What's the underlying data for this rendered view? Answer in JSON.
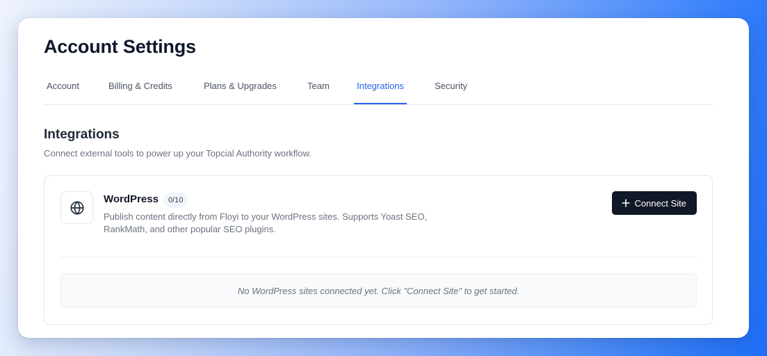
{
  "page": {
    "title": "Account Settings"
  },
  "tabs": [
    {
      "label": "Account"
    },
    {
      "label": "Billing & Credits"
    },
    {
      "label": "Plans & Upgrades"
    },
    {
      "label": "Team"
    },
    {
      "label": "Integrations",
      "active": true
    },
    {
      "label": "Security"
    }
  ],
  "section": {
    "title": "Integrations",
    "description": "Connect external tools to power up your Topcial Authority workflow."
  },
  "integration": {
    "icon": "globe-icon",
    "name": "WordPress",
    "count": "0/10",
    "description": "Publish content directly from Floyi to your WordPress sites. Supports Yoast SEO, RankMath, and other popular SEO plugins.",
    "connect_label": "Connect Site",
    "empty_message": "No WordPress sites connected yet. Click \"Connect Site\" to get started."
  },
  "colors": {
    "accent": "#2563eb",
    "button_bg": "#111827"
  }
}
